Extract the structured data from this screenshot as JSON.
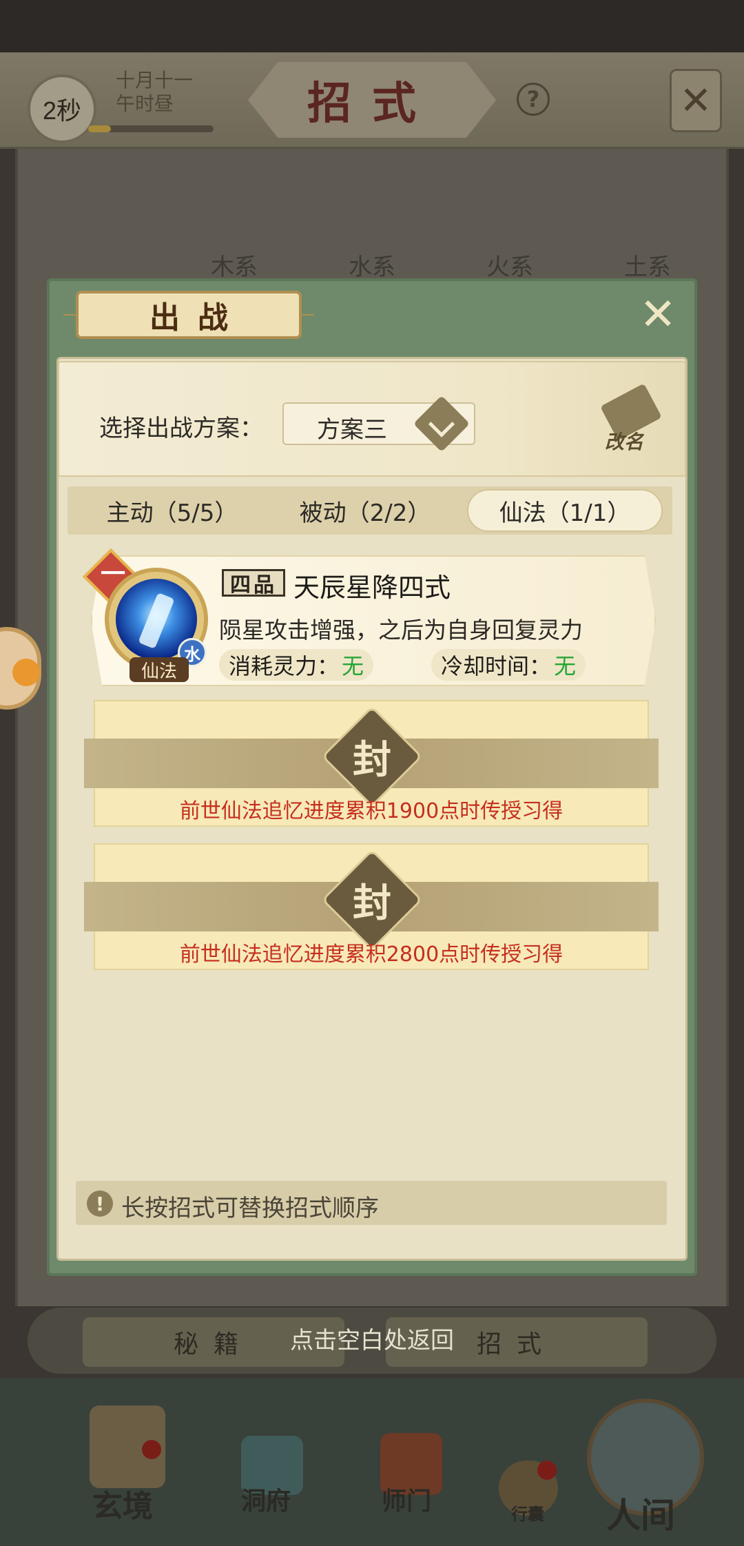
{
  "background": {
    "timer": "2秒",
    "date_line1": "十月十一",
    "date_line2": "午时昼",
    "time_progress": 0.18,
    "title": "招式",
    "help_icon": "question-icon",
    "close_icon": "close-icon",
    "tabs": [
      "木系",
      "水系",
      "火系",
      "土系"
    ],
    "bottom_buttons": [
      "秘籍",
      "招式"
    ],
    "nav": [
      "玄境",
      "洞府",
      "师门",
      "行囊",
      "人间"
    ]
  },
  "modal": {
    "title": "出战",
    "close_icon": "close-icon",
    "plan_label": "选择出战方案：",
    "plan_value": "方案三",
    "rename_label": "改名",
    "tabs": [
      {
        "label": "主动（5/5）",
        "active": false
      },
      {
        "label": "被动（2/2）",
        "active": false
      },
      {
        "label": "仙法（1/1）",
        "active": true
      }
    ],
    "skill": {
      "rank": "一",
      "grade": "四品",
      "name": "天辰星降四式",
      "description": "陨星攻击增强，之后为自身回复灵力",
      "element": "水",
      "type": "仙法",
      "cost_label": "消耗灵力：",
      "cost_value": "无",
      "cooldown_label": "冷却时间：",
      "cooldown_value": "无"
    },
    "locked_slots": [
      {
        "seal": "封",
        "requirement": "前世仙法追忆进度累积1900点时传授习得"
      },
      {
        "seal": "封",
        "requirement": "前世仙法追忆进度累积2800点时传授习得"
      }
    ],
    "hint": "长按招式可替换招式顺序"
  },
  "tap_to_return": "点击空白处返回",
  "colors": {
    "modal_frame": "#6e8a6b",
    "panel": "#e9e1c6",
    "locked_text": "#c52e1e",
    "free_value": "#27a536"
  }
}
